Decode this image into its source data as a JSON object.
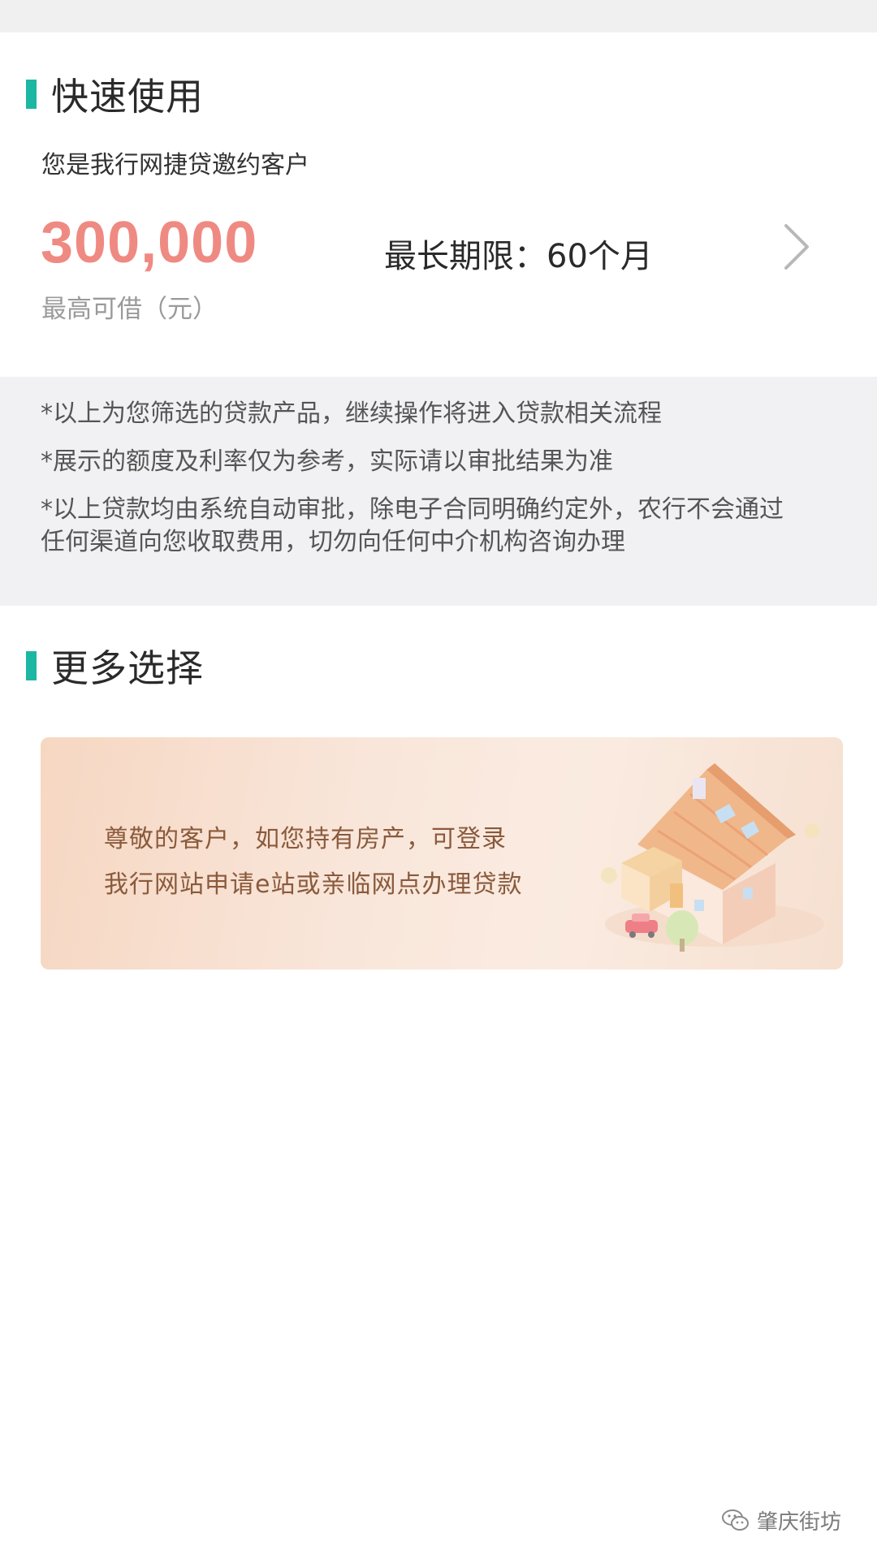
{
  "quick_use": {
    "title": "快速使用",
    "subtitle": "您是我行网捷贷邀约客户",
    "amount": "300,000",
    "amount_label": "最高可借（元）",
    "term": "最长期限：60个月"
  },
  "notice": {
    "line1": "*以上为您筛选的贷款产品，继续操作将进入贷款相关流程",
    "line2": "*展示的额度及利率仅为参考，实际请以审批结果为准",
    "line3a": "*以上贷款均由系统自动审批，除电子合同明确约定外，农行不会通过",
    "line3b": "任何渠道向您收取费用，切勿向任何中介机构咨询办理"
  },
  "more": {
    "title": "更多选择",
    "promo_line1": "尊敬的客户，如您持有房产，可登录",
    "promo_line2": "我行网站申请e站或亲临网点办理贷款"
  },
  "watermark": {
    "text": "肇庆街坊"
  },
  "colors": {
    "accent": "#1bb7a3",
    "amount": "#ef8a83",
    "promo_text": "#8a5a3c"
  }
}
